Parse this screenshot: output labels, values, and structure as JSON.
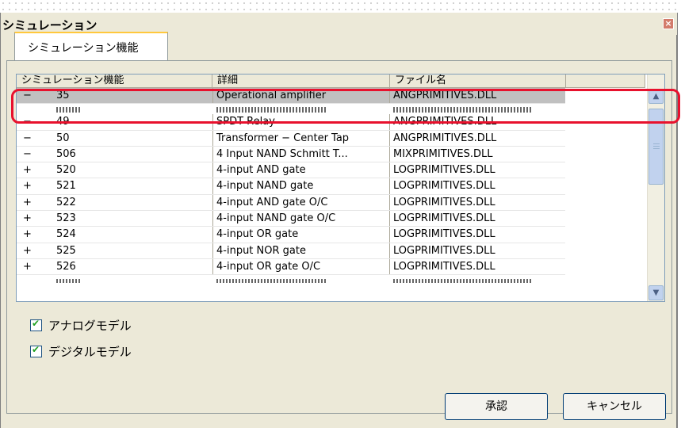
{
  "window": {
    "title": "シミュレーション",
    "close_glyph": "×"
  },
  "tabs": [
    {
      "label": "シミュレーション機能"
    }
  ],
  "list": {
    "columns": [
      "シミュレーション機能",
      "詳細",
      "ファイル名"
    ],
    "rows": [
      {
        "sign": "−",
        "id": "35",
        "detail": "Operational amplifier",
        "file": "ANGPRIMITIVES.DLL",
        "selected": true
      },
      {
        "sign": "−",
        "id": "49",
        "detail": "SPDT Relay",
        "file": "ANGPRIMITIVES.DLL"
      },
      {
        "sign": "−",
        "id": "50",
        "detail": "Transformer − Center Tap",
        "file": "ANGPRIMITIVES.DLL"
      },
      {
        "sign": "−",
        "id": "506",
        "detail": "4 Input NAND Schmitt T...",
        "file": "MIXPRIMITIVES.DLL"
      },
      {
        "sign": "+",
        "id": "520",
        "detail": "4-input AND gate",
        "file": "LOGPRIMITIVES.DLL"
      },
      {
        "sign": "+",
        "id": "521",
        "detail": "4-input NAND gate",
        "file": "LOGPRIMITIVES.DLL"
      },
      {
        "sign": "+",
        "id": "522",
        "detail": "4-input AND gate O/C",
        "file": "LOGPRIMITIVES.DLL"
      },
      {
        "sign": "+",
        "id": "523",
        "detail": "4-input NAND gate O/C",
        "file": "LOGPRIMITIVES.DLL"
      },
      {
        "sign": "+",
        "id": "524",
        "detail": "4-input OR gate",
        "file": "LOGPRIMITIVES.DLL"
      },
      {
        "sign": "+",
        "id": "525",
        "detail": "4-input NOR gate",
        "file": "LOGPRIMITIVES.DLL"
      },
      {
        "sign": "+",
        "id": "526",
        "detail": "4-input OR gate O/C",
        "file": "LOGPRIMITIVES.DLL"
      }
    ]
  },
  "checkboxes": {
    "analog": {
      "label": "アナログモデル",
      "checked": true
    },
    "digital": {
      "label": "デジタルモデル",
      "checked": true
    }
  },
  "buttons": {
    "ok": "承認",
    "cancel": "キャンセル"
  },
  "colors": {
    "highlight": "#e8112d",
    "dialog_bg": "#ece9d8",
    "selected_row": "#c0c0c0"
  }
}
